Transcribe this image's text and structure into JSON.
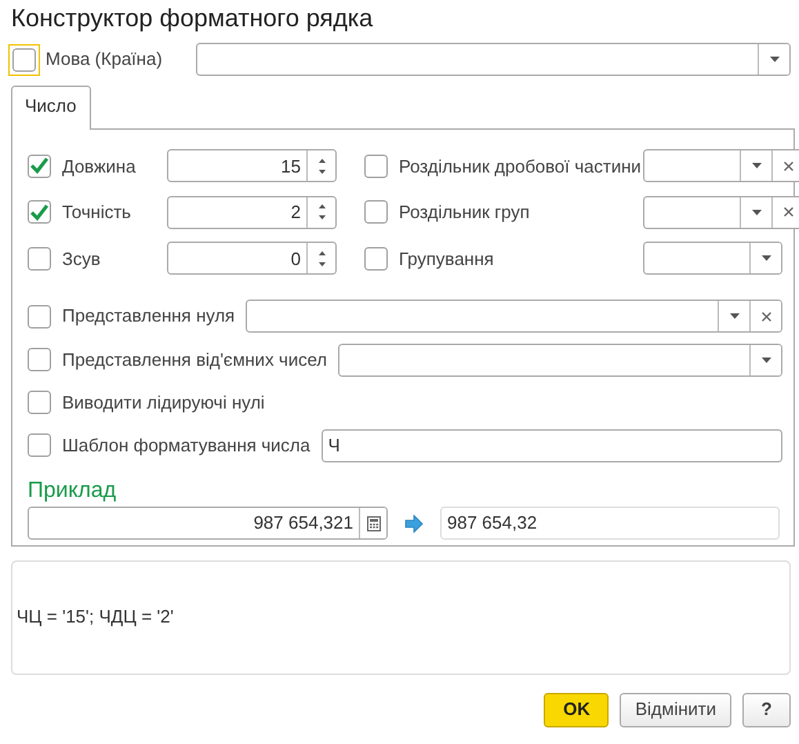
{
  "window": {
    "title": "Конструктор форматного рядка"
  },
  "language": {
    "label": "Мова (Країна)",
    "checked": false,
    "focused": true
  },
  "tabs": [
    {
      "label": "Число",
      "selected": true
    }
  ],
  "spin_fields": [
    {
      "label": "Довжина",
      "checked": true,
      "value": "15"
    },
    {
      "label": "Точність",
      "checked": true,
      "value": "2"
    },
    {
      "label": "Зсув",
      "checked": false,
      "value": "0"
    }
  ],
  "side_fields": [
    {
      "label": "Роздільник дробової частини",
      "checked": false,
      "clearable": true
    },
    {
      "label": "Роздільник груп",
      "checked": false,
      "clearable": true
    },
    {
      "label": "Групування",
      "checked": false,
      "clearable": false
    }
  ],
  "options": [
    {
      "kind": "combo",
      "label": "Представлення нуля",
      "checked": false,
      "clearable": true
    },
    {
      "kind": "combo",
      "label": "Представлення від'ємних чисел",
      "checked": false,
      "clearable": false
    },
    {
      "kind": "check",
      "label": "Виводити лідируючі нулі",
      "checked": false
    },
    {
      "kind": "text",
      "label": "Шаблон форматування числа",
      "checked": false,
      "value": "Ч"
    }
  ],
  "example": {
    "heading": "Приклад",
    "input": "987 654,321",
    "output": "987 654,32"
  },
  "result": "ЧЦ = '15'; ЧДЦ = '2'",
  "buttons": [
    {
      "label": "OK",
      "kind": "primary"
    },
    {
      "label": "Відмінити",
      "kind": "normal"
    },
    {
      "label": "?",
      "kind": "normal"
    }
  ]
}
